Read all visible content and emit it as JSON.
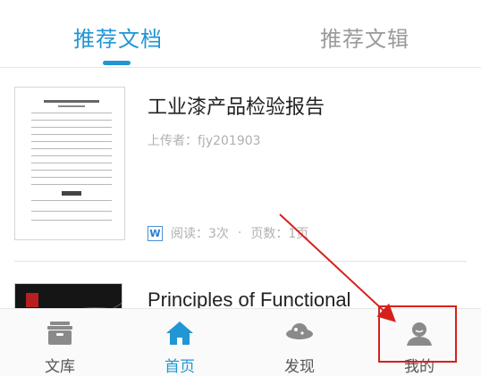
{
  "tabs": [
    {
      "label": "推荐文档",
      "active": true
    },
    {
      "label": "推荐文辑",
      "active": false
    }
  ],
  "documents": [
    {
      "title": "工业漆产品检验报告",
      "uploader": "上传者：fjy201903",
      "file_type_icon": "W",
      "reads": "阅读：3次",
      "separator": "·",
      "pages": "页数：1页"
    },
    {
      "title": "Principles of Functional"
    }
  ],
  "bottom_nav": [
    {
      "label": "文库",
      "icon": "library-icon",
      "active": false
    },
    {
      "label": "首页",
      "icon": "home-icon",
      "active": true
    },
    {
      "label": "发现",
      "icon": "discover-icon",
      "active": false
    },
    {
      "label": "我的",
      "icon": "profile-icon",
      "active": false
    }
  ],
  "colors": {
    "accent": "#2196d3",
    "annotation": "#d6201c",
    "text_primary": "#222222",
    "text_muted": "#b0b0b0"
  }
}
